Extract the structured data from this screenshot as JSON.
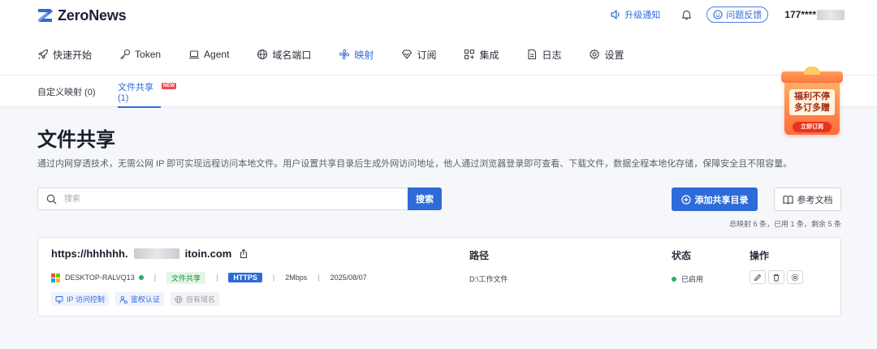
{
  "brand": {
    "name": "ZeroNews"
  },
  "header": {
    "upgrade_label": "升级通知",
    "feedback_label": "问题反馈",
    "user_phone": "177****"
  },
  "nav": [
    {
      "label": "快速开始",
      "icon": "rocket-icon"
    },
    {
      "label": "Token",
      "icon": "key-icon"
    },
    {
      "label": "Agent",
      "icon": "laptop-icon"
    },
    {
      "label": "域名端口",
      "icon": "globe-icon"
    },
    {
      "label": "映射",
      "icon": "fan-icon",
      "active": true
    },
    {
      "label": "订阅",
      "icon": "diamond-icon"
    },
    {
      "label": "集成",
      "icon": "grid-icon"
    },
    {
      "label": "日志",
      "icon": "document-icon"
    },
    {
      "label": "设置",
      "icon": "gear-icon"
    }
  ],
  "subtabs": [
    {
      "label": "自定义映射 (0)"
    },
    {
      "label": "文件共享 (1)",
      "badge": "NEW",
      "active": true
    }
  ],
  "promo": {
    "line1": "福利不停",
    "line2": "多订多赠",
    "button": "立即订阅"
  },
  "page": {
    "title": "文件共享",
    "description": "通过内网穿透技术，无需公网 IP 即可实现远程访问本地文件。用户设置共享目录后生成外网访问地址，他人通过浏览器登录即可查看、下载文件，数据全程本地化存储，保障安全且不限容量。"
  },
  "search": {
    "placeholder": "搜索",
    "button_label": "搜索"
  },
  "actions": {
    "add_label": "添加共享目录",
    "doc_label": "参考文档"
  },
  "summary": "总映射 6 条，已用 1 条，剩余 5 条",
  "columns": {
    "path": "路径",
    "status": "状态",
    "ops": "操作"
  },
  "mapping": {
    "url_prefix": "https://hhhhhh.",
    "url_suffix": "itoin.com",
    "device": "DESKTOP-RALVQ13",
    "type_tag": "文件共享",
    "protocol": "HTTPS",
    "bandwidth": "2Mbps",
    "date": "2025/08/07",
    "path": "D:\\工作文件",
    "status": "已启用",
    "features": [
      {
        "label": "IP 访问控制",
        "icon": "monitor-icon",
        "enabled": true
      },
      {
        "label": "鉴权认证",
        "icon": "user-lock-icon",
        "enabled": true
      },
      {
        "label": "自有域名",
        "icon": "globe-icon",
        "enabled": false
      }
    ]
  },
  "colors": {
    "accent": "#2f6bd8",
    "success": "#23b35c",
    "tag_green_bg": "#e3f6e7",
    "promo_red": "#e8331e"
  }
}
